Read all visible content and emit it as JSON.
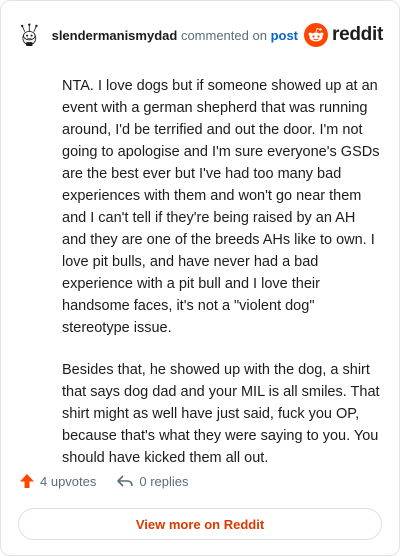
{
  "header": {
    "username": "slendermanismydad",
    "verb": "commented on",
    "post_link": "post",
    "brand": "reddit"
  },
  "comment": {
    "paragraphs": [
      "NTA. I love dogs but if someone showed up at an event with a german shepherd that was running around, I'd be terrified and out the door. I'm not going to apologise and I'm sure everyone's GSDs are the best ever but I've had too many bad experiences with them and won't go near them and I can't tell if they're being raised by an AH and they are one of the breeds AHs like to own. I love pit bulls, and have never had a bad experience with a pit bull and I love their handsome faces, it's not a \"violent dog\" stereotype issue.",
      "Besides that, he showed up with the dog, a shirt that says dog dad and your MIL is all smiles. That shirt might as well have just said, fuck you OP, because that's what they were saying to you. You should have kicked them all out."
    ]
  },
  "actions": {
    "upvotes": "4 upvotes",
    "replies": "0 replies"
  },
  "footer": {
    "view_more": "View more on Reddit"
  },
  "colors": {
    "brand": "#ff4500",
    "link": "#0a66c2",
    "muted": "#576f76",
    "cta": "#d93a00"
  },
  "icons": {
    "avatar": "snoo-avatar-icon",
    "logo": "reddit-snoo-icon",
    "upvote": "upvote-arrow-icon",
    "reply": "reply-arrow-icon"
  }
}
